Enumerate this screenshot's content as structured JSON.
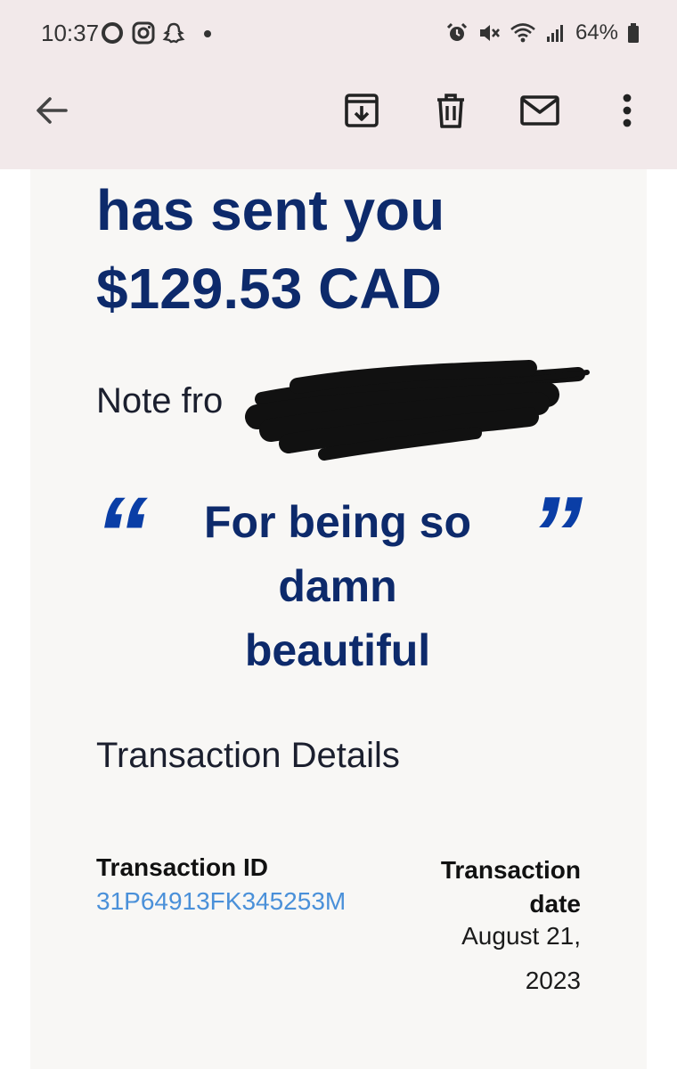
{
  "status_bar": {
    "time": "10:37",
    "battery": "64%",
    "left_icons": [
      "circle-notification-icon",
      "instagram-icon",
      "snapchat-icon",
      "more-dot-icon"
    ],
    "right_icons": [
      "alarm-icon",
      "mute-icon",
      "wifi-icon",
      "signal-icon",
      "battery-icon"
    ]
  },
  "toolbar": {
    "back_icon": "arrow-left-icon",
    "actions": [
      "archive-icon",
      "delete-icon",
      "mail-icon",
      "more-vert-icon"
    ]
  },
  "email": {
    "headline_line1": "has sent you",
    "headline_line2": "$129.53 CAD",
    "note_label": "Note fro",
    "quote_open": "“",
    "quote_close": "”",
    "quote_line1": "For being so",
    "quote_line2": "damn",
    "quote_line3": "beautiful",
    "section_title": "Transaction Details",
    "transaction_id_label": "Transaction ID",
    "transaction_id_value": "31P64913FK345253M",
    "transaction_date_label_1": "Transaction",
    "transaction_date_label_2": "date",
    "transaction_date_value_1": "August 21,",
    "transaction_date_value_2": "2023"
  },
  "colors": {
    "chrome_bg": "#f2e9ea",
    "email_bg": "#f8f7f5",
    "headline": "#0d2a6b",
    "quote_marks": "#0a3ea6",
    "link": "#4a90d9"
  }
}
